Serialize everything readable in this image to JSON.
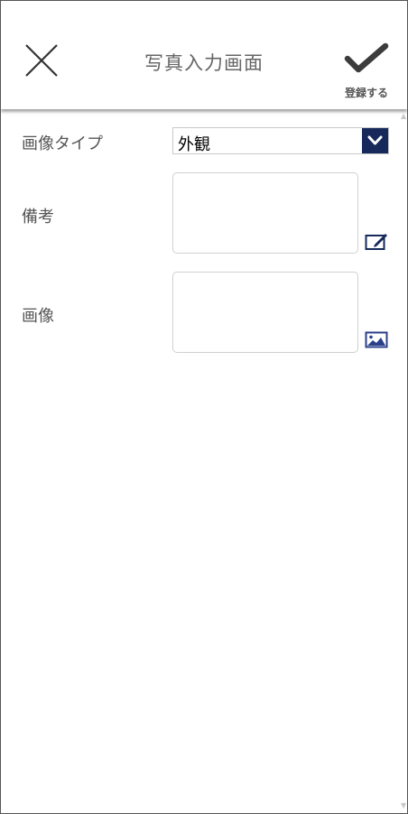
{
  "header": {
    "title": "写真入力画面",
    "register_label": "登録する"
  },
  "form": {
    "image_type": {
      "label": "画像タイプ",
      "value": "外観"
    },
    "remarks": {
      "label": "備考",
      "value": ""
    },
    "image": {
      "label": "画像"
    }
  },
  "icons": {
    "close": "close-icon",
    "register": "checkmark-icon",
    "dropdown": "chevron-down-icon",
    "edit": "edit-icon",
    "image": "image-icon"
  },
  "colors": {
    "accent": "#16295a",
    "icon_blue": "#2a3f8a",
    "text": "#555555"
  }
}
